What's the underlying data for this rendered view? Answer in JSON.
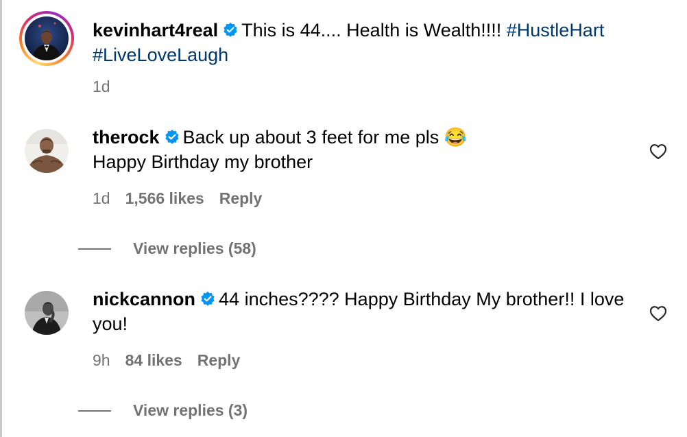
{
  "caption": {
    "username": "kevinhart4real",
    "text": "This is 44.... Health is Wealth!!!! ",
    "hashtag1": "#HustleHart",
    "hashtag2": "#LiveLoveLaugh",
    "time": "1d"
  },
  "comments": [
    {
      "username": "therock",
      "line1": "Back up about 3 feet for me pls 😂",
      "line2": "Happy Birthday my brother",
      "time": "1d",
      "likes": "1,566 likes",
      "reply": "Reply",
      "view_replies": "View replies (58)"
    },
    {
      "username": "nickcannon",
      "text": "44 inches???? Happy Birthday My brother!! I love you!",
      "time": "9h",
      "likes": "84 likes",
      "reply": "Reply",
      "view_replies": "View replies (3)"
    }
  ],
  "icons": {
    "verified": "verified-badge-icon",
    "like": "heart-icon"
  },
  "colors": {
    "verified_blue": "#0095f6",
    "hashtag": "#00376b",
    "secondary_text": "#737373"
  }
}
